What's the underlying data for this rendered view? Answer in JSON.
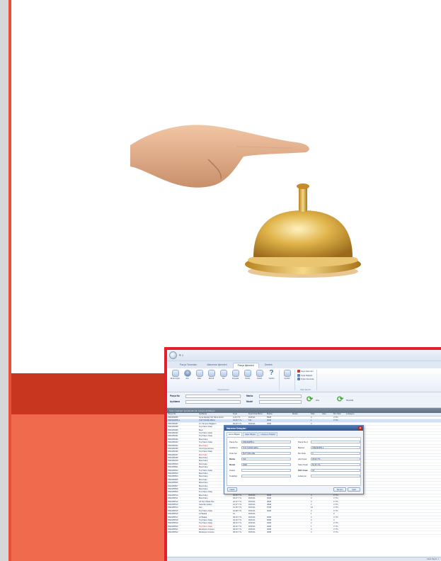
{
  "app": {
    "quick_access": "▾ ⌕",
    "tabs": [
      "Parça Tanımları",
      "Malzeme İşlemleri",
      "Parça İşlemleri",
      "Destek"
    ],
    "active_tab": 2,
    "ribbon_group1": [
      {
        "icon": "globe-icon",
        "label": "Ekran Ayarı"
      },
      {
        "icon": "person-icon",
        "label": "Ara"
      },
      {
        "icon": "doc-icon",
        "label": "Ekle"
      },
      {
        "icon": "doc-icon",
        "label": "Düzelt"
      },
      {
        "icon": "doc-icon",
        "label": "Sil"
      },
      {
        "icon": "doc-icon",
        "label": "Kopyala"
      },
      {
        "icon": "doc-icon",
        "label": "Yazdır"
      },
      {
        "icon": "doc-icon",
        "label": "Listele"
      },
      {
        "icon": "question-icon",
        "label": "Yardım"
      }
    ],
    "ribbon_group1_caption": "Parça İşlemleri",
    "ribbon_group2": [
      {
        "icon": "globe-icon",
        "label": "Ayarlar"
      }
    ],
    "ribbon_small": [
      "Kayıt İşlemleri",
      "Fiyat Değiştir",
      "Toplu Güncelle"
    ],
    "ribbon_small_caption": "Diğer İşlemler",
    "filter": {
      "parca_no_label": "Parça No",
      "aciklama_label": "Açıklama",
      "marka_label": "Marka",
      "model_label": "Model",
      "search_label": "Ara",
      "clear_label": "Temizle"
    },
    "band_text": "Sütun başlığını gruplamak için buraya sürükleyin",
    "columns": [
      "Parça No",
      "Açıklama",
      "Fiyat",
      "Fiyat Para Birimi",
      "Marka",
      "Model",
      "Stok",
      "Adet",
      "Min Stok",
      "Lokasyon"
    ],
    "rows": [
      [
        "PM2494055",
        "Ayna Kapağı Sol Tahra Göstl",
        "4,23 YTL",
        "ROKSA",
        "5528",
        "",
        "4",
        "",
        "3 YTL",
        ""
      ],
      [
        "PM2494055-1",
        "TOZ TAKIMI ARKA",
        "45,00 YTL",
        "KIA",
        "3038",
        "",
        "1",
        "",
        "3 YTL",
        ""
      ],
      [
        "PM2495487",
        "Ön Tampon Bağlantı",
        "36,00 YTL",
        "ROKSA",
        "3008",
        "",
        "3",
        "",
        "",
        ""
      ],
      [
        "PM2495488",
        "Top Takım Kalıp",
        "",
        "",
        "",
        "",
        "",
        "",
        "",
        ""
      ],
      [
        "PM2495489",
        "Buat",
        "",
        "",
        "",
        "",
        "",
        "",
        "",
        ""
      ],
      [
        "PM2495490",
        "Top Takım Kalıp",
        "",
        "",
        "",
        "",
        "",
        "",
        "",
        ""
      ],
      [
        "PM2495491",
        "Top Takım Kalıp",
        "",
        "",
        "",
        "",
        "",
        "",
        "",
        ""
      ],
      [
        "PM2495492",
        "Buat Kalıp",
        "",
        "",
        "",
        "",
        "",
        "",
        "",
        ""
      ],
      [
        "PM2495493",
        "Top Takım Kalıp",
        "",
        "",
        "",
        "",
        "",
        "",
        "",
        ""
      ],
      [
        "PM2495494",
        "Buat Kalıp",
        "",
        "",
        "",
        "",
        "",
        "",
        "",
        ""
      ],
      [
        "PM2495495",
        "Ana Fiyat Hizmet",
        "",
        "",
        "",
        "",
        "",
        "",
        "",
        ""
      ],
      [
        "PM2495496",
        "Top Takım Kalıp",
        "",
        "",
        "",
        "",
        "",
        "",
        "",
        ""
      ],
      [
        "PM2495497",
        "Mini Kalıp",
        "",
        "",
        "",
        "",
        "",
        "",
        "",
        ""
      ],
      [
        "PM2495498",
        "Buat Kalıp",
        "",
        "",
        "",
        "",
        "",
        "",
        "",
        ""
      ],
      [
        "PM2495499",
        "Buat Kalıp",
        "",
        "",
        "",
        "",
        "",
        "",
        "",
        ""
      ],
      [
        "PM2495500",
        "Mini Kalıp",
        "",
        "",
        "",
        "",
        "",
        "",
        "",
        ""
      ],
      [
        "PM2495501",
        "Buat Kalıp",
        "",
        "",
        "",
        "",
        "",
        "",
        "",
        ""
      ],
      [
        "PM2495502",
        "Top Takım Kalıp",
        "",
        "",
        "",
        "",
        "",
        "",
        "",
        ""
      ],
      [
        "PM2495503",
        "Buat Kalıp",
        "",
        "",
        "",
        "",
        "",
        "",
        "",
        ""
      ],
      [
        "PM2495504",
        "Buat Kalıp",
        "",
        "",
        "",
        "",
        "",
        "",
        "",
        ""
      ],
      [
        "PM2495505",
        "Mini Kalıp",
        "",
        "",
        "",
        "",
        "",
        "",
        "",
        ""
      ],
      [
        "PM2495506",
        "Buat Kalıp",
        "",
        "",
        "",
        "",
        "",
        "",
        "",
        ""
      ],
      [
        "PM2495507",
        "Buat Kalıp",
        "",
        "",
        "",
        "",
        "",
        "",
        "",
        ""
      ],
      [
        "PM2495508",
        "Buat Kalıp",
        "",
        "",
        "",
        "",
        "",
        "",
        "",
        ""
      ],
      [
        "PM2495509",
        "Top Takım Kalıp",
        "53,00 YTL",
        "ROKSA",
        "3578",
        "",
        "2",
        "",
        "3 YTL",
        ""
      ],
      [
        "PM2495510",
        "Buat Kalıp",
        "46,50 YTL",
        "ROKSA",
        "3048",
        "",
        "4",
        "",
        "3 YTL",
        ""
      ],
      [
        "PM2495511",
        "Buat Kalıp",
        "18,07 YTL",
        "ROKSA",
        "3048",
        "",
        "3",
        "",
        "3 YTL",
        ""
      ],
      [
        "PM2495512",
        "Alt Tarz Metal Pas",
        "22,37 YTL",
        "ROKSA",
        "3848",
        "",
        "4",
        "",
        "3 YTL",
        ""
      ],
      [
        "PM2495513",
        "Kalorifer Kolları",
        "16,37 YTL",
        "ROKSA",
        "3848",
        "",
        "2",
        "",
        "3 YTL",
        ""
      ],
      [
        "PM2495514",
        "Fan",
        "21,35 YTL",
        "ROKSA",
        "5748",
        "",
        "10",
        "",
        "3 YTL",
        ""
      ],
      [
        "PM2495515",
        "Top Takım Kalıp",
        "34,98 YTL",
        "ROKSA",
        "3048",
        "",
        "3",
        "",
        "3 YTL",
        ""
      ],
      [
        "PM2495516",
        "Lif Balata",
        "12",
        "ROKSA",
        "",
        "",
        "1",
        "",
        "0",
        ""
      ],
      [
        "PM2495517",
        "Lif Balata",
        "38,15 YTL",
        "ROKSA",
        "3008",
        "",
        "4",
        "",
        "3 YTL",
        ""
      ],
      [
        "PM2495518",
        "Top Takım Kalıp",
        "32,00 YTL",
        "ROKSA",
        "5508",
        "",
        "3",
        "",
        "3",
        ""
      ],
      [
        "PM2495519",
        "Top Takım Kalıp",
        "38,00 YTL",
        "ROKSA",
        "3008",
        "",
        "2",
        "",
        "3 YTL",
        ""
      ],
      [
        "PM2495520",
        "Top Takım Kalıp",
        "36,00 YTL",
        "ROKSA",
        "3008",
        "",
        "1",
        "",
        "3 YTL",
        ""
      ],
      [
        "PM2495521",
        "Direksiyon Kutusu",
        "38,00 YTL",
        "ROKSA",
        "3008",
        "",
        "4",
        "",
        "3 YTL",
        ""
      ],
      [
        "PM2495522",
        "Direksiyon Kutusu",
        "38,00 YTL",
        "ROKSA",
        "3008",
        "",
        "4",
        "",
        "3 YTL",
        ""
      ]
    ],
    "selected_row": 1,
    "red_rows": [
      9,
      12,
      35
    ],
    "status_text": "Kayıt Sayısı: 1",
    "dialog": {
      "title": "Malzeme Detayları",
      "tabs": [
        "Genel Bilgiler",
        "Diğer Bilgiler",
        "Lokasyon Bilgileri"
      ],
      "active_tab": 0,
      "left_fields": [
        {
          "label": "Parça No",
          "value": "PM2494055-1",
          "bold": false
        },
        {
          "label": "Açıklama",
          "value": "TOZ TAKIMI ARKA",
          "bold": false
        },
        {
          "label": "Ürün Adı",
          "value": "BUTYNKLASE",
          "bold": false
        },
        {
          "label": "Marka",
          "value": "KIA",
          "bold": true
        },
        {
          "label": "Model",
          "value": "3038",
          "bold": true
        },
        {
          "label": "Üretici",
          "value": "",
          "bold": false
        },
        {
          "label": "Tedarikçi",
          "value": "",
          "bold": false
        }
      ],
      "right_fields": [
        {
          "label": "Parça No 2",
          "value": "",
          "bold": false
        },
        {
          "label": "Barkod",
          "value": "PM2494055-1",
          "bold": false
        },
        {
          "label": "Min Stok",
          "value": "3",
          "bold": false
        },
        {
          "label": "Alış Fiyatı",
          "value": "45,00 YTL",
          "bold": false
        },
        {
          "label": "Satış Fiyatı",
          "value": "56,25 YTL",
          "bold": false
        },
        {
          "label": "KDV Oranı",
          "value": "18",
          "bold": true
        },
        {
          "label": "Lokasyon",
          "value": "",
          "bold": false
        }
      ],
      "min_stok_unit": "Adet",
      "ok_label": "Tamam",
      "cancel_label": "İptal",
      "bottom_left": "Yazdır"
    }
  }
}
